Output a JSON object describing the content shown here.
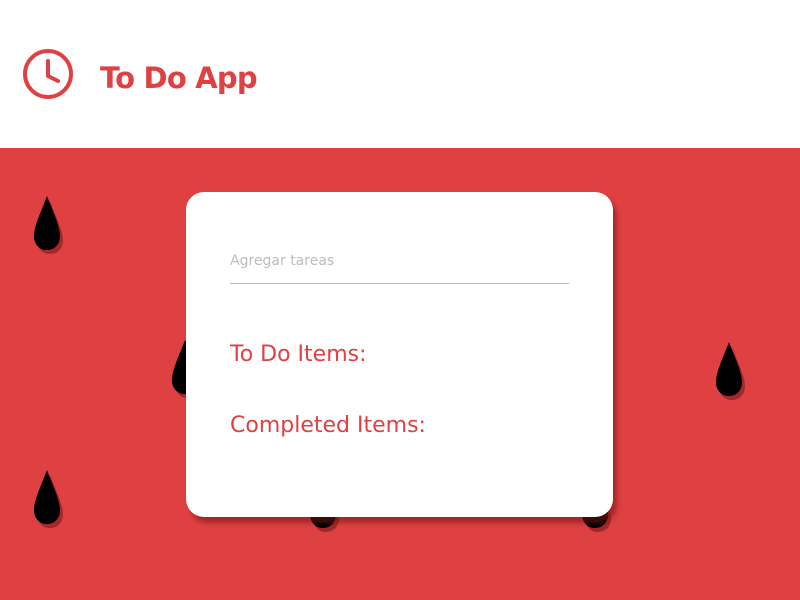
{
  "colors": {
    "accent": "#df4042",
    "seed": "#000000",
    "card": "#ffffff"
  },
  "header": {
    "icon": "clock-icon",
    "title": "To Do App"
  },
  "task_input": {
    "placeholder": "Agregar tareas",
    "value": ""
  },
  "todo_section": {
    "heading": "To Do Items:",
    "items": []
  },
  "completed_section": {
    "heading": "Completed Items:",
    "items": []
  }
}
